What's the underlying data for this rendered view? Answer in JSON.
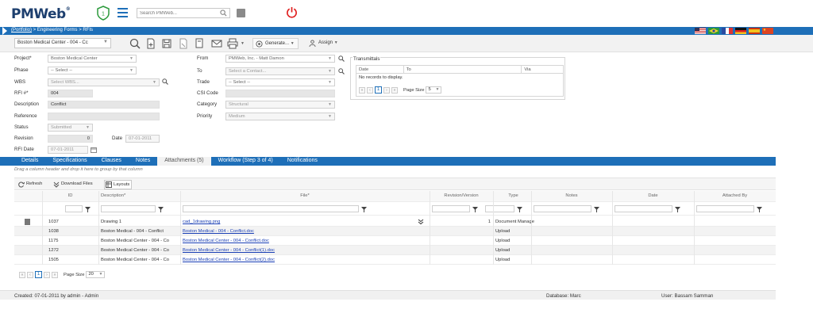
{
  "header": {
    "logo_main": "PMWeb",
    "logo_mark": "®",
    "search_placeholder": "Search PMWeb..."
  },
  "breadcrumb": {
    "root": "(Portfolio)",
    "trail": " > Engineering Forms > RFIs"
  },
  "toolbar": {
    "record_select": "Boston Medical Center - 004 - Cc",
    "generate_label": "Generate...",
    "assign_label": "Assign"
  },
  "form": {
    "project": {
      "label": "Project*",
      "value": "Boston Medical Center"
    },
    "phase": {
      "label": "Phase",
      "value": "-- Select --"
    },
    "wbs": {
      "label": "WBS",
      "value": "Select WBS..."
    },
    "rfi_no": {
      "label": "RFI #*",
      "value": "004"
    },
    "description": {
      "label": "Description",
      "value": "Conflict"
    },
    "reference": {
      "label": "Reference",
      "value": ""
    },
    "status": {
      "label": "Status",
      "value": "Submitted"
    },
    "revision": {
      "label": "Revision",
      "value": "0"
    },
    "date": {
      "label": "Date",
      "value": "07-01-2011"
    },
    "rfi_date": {
      "label": "RFI Date",
      "value": "07-01-2011"
    },
    "from": {
      "label": "From",
      "value": "PMWeb, Inc. - Matt Damon"
    },
    "to": {
      "label": "To",
      "value": "Select a Contact..."
    },
    "trade": {
      "label": "Trade",
      "value": "-- Select --"
    },
    "csi_code": {
      "label": "CSI Code",
      "value": ""
    },
    "category": {
      "label": "Category",
      "value": "Structural"
    },
    "priority": {
      "label": "Priority",
      "value": "Medium"
    }
  },
  "transmittals": {
    "title": "Transmittals",
    "columns": [
      "Date",
      "To",
      "Via"
    ],
    "empty_text": "No records to display.",
    "page": "1",
    "page_size_label": "Page Size",
    "page_size": "5"
  },
  "tabs": [
    {
      "label": "Details"
    },
    {
      "label": "Specifications"
    },
    {
      "label": "Clauses"
    },
    {
      "label": "Notes"
    },
    {
      "label": "Attachments (5)"
    },
    {
      "label": "Workflow (Step 3 of 4)"
    },
    {
      "label": "Notifications"
    }
  ],
  "attachments": {
    "group_hint": "Drag a column header and drop it here to group by that column",
    "refresh_label": "Refresh",
    "download_label": "Download Files",
    "layouts_label": "Layouts",
    "columns": [
      "ID",
      "Description*",
      "File*",
      "Revision/Version",
      "Type",
      "Notes",
      "Date",
      "Attached By"
    ],
    "rows": [
      {
        "id": "1037",
        "description": "Drawing 1",
        "file": "cad_1drawing.png",
        "revision": "1",
        "type": "Document Manage"
      },
      {
        "id": "1038",
        "description": "Boston Medical - 004 - Conflict",
        "file": "Boston Medical - 004 - Conflict.doc",
        "revision": "",
        "type": "Upload"
      },
      {
        "id": "1175",
        "description": "Boston Medical Center - 004 - Co",
        "file": "Boston Medical Center - 004 - Conflict.doc",
        "revision": "",
        "type": "Upload"
      },
      {
        "id": "1272",
        "description": "Boston Medical Center - 004 - Co",
        "file": "Boston Medical Center - 004 - Conflict(1).doc",
        "revision": "",
        "type": "Upload"
      },
      {
        "id": "1505",
        "description": "Boston Medical Center - 004 - Co",
        "file": "Boston Medical Center - 004 - Conflict(2).doc",
        "revision": "",
        "type": "Upload"
      }
    ],
    "page": "1",
    "page_size_label": "Page Size",
    "page_size": "20"
  },
  "footer": {
    "created": "Created:  07-01-2011 by admin - Admin",
    "database": "Database:  Marc",
    "user": "User:  Bassam Samman"
  },
  "colors": {
    "accent": "#1e6fb8",
    "power": "#e02020",
    "logo": "#1d3f6e"
  }
}
